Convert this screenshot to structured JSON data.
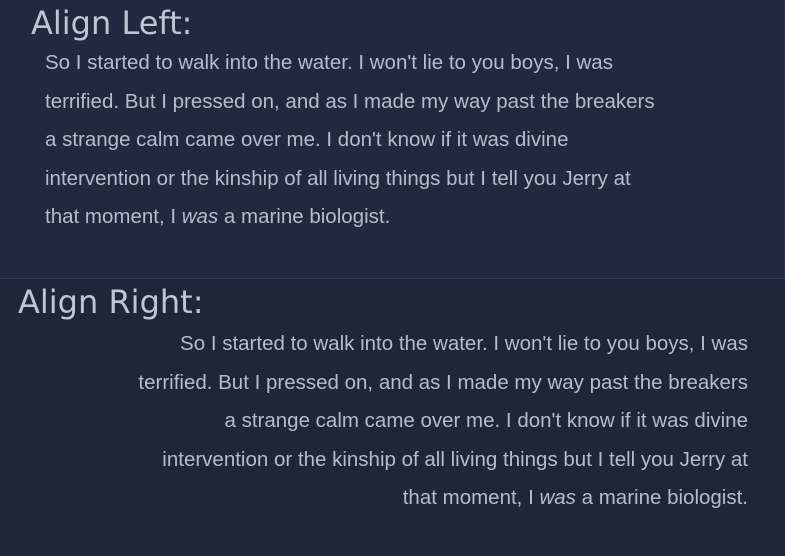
{
  "align_left": {
    "heading": "Align Left:",
    "lines": [
      "So I started to walk into the water. I won't lie to you boys, I was",
      "terrified. But I pressed on, and as I made my way past the breakers",
      "a strange calm came over me. I don't know if it was divine",
      "intervention or the kinship of all living things but I tell you Jerry at"
    ],
    "last_line_before": "that moment, I ",
    "last_line_emphasis": "was",
    "last_line_after": " a marine biologist."
  },
  "align_right": {
    "heading": "Align Right:",
    "lines": [
      "So I started to walk into the water. I won't lie to you boys, I was",
      "terrified. But I pressed on, and as I made my way past the breakers",
      "a strange calm came over me. I don't know if it was divine",
      "intervention or the kinship of all living things but I tell you Jerry at"
    ],
    "last_line_before": "that moment, I ",
    "last_line_emphasis": "was",
    "last_line_after": " a marine biologist."
  }
}
